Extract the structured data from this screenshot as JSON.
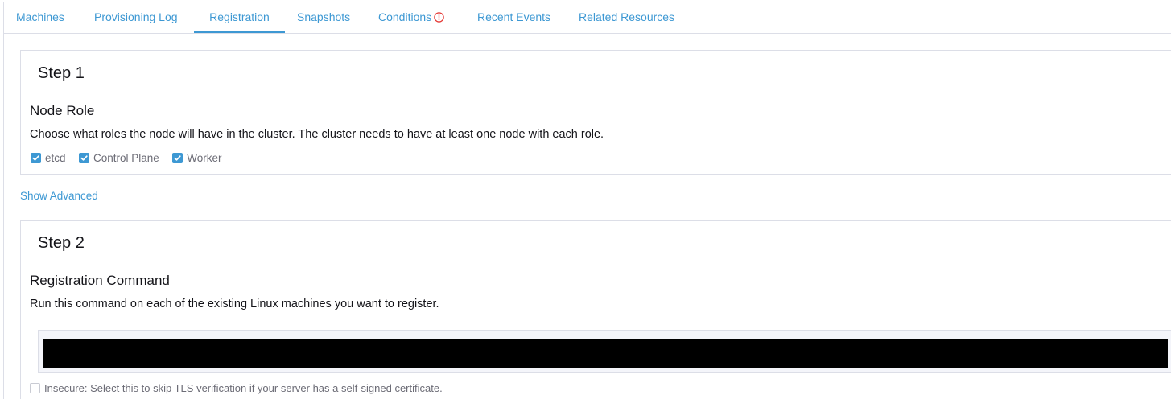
{
  "tabs": [
    {
      "label": "Machines"
    },
    {
      "label": "Provisioning Log"
    },
    {
      "label": "Registration"
    },
    {
      "label": "Snapshots"
    },
    {
      "label": "Conditions"
    },
    {
      "label": "Recent Events"
    },
    {
      "label": "Related Resources"
    }
  ],
  "active_tab": "Registration",
  "colors": {
    "accent": "#3d98d3",
    "warning": "#e53935",
    "border": "#dcdee7"
  },
  "step1": {
    "title": "Step 1",
    "section_title": "Node Role",
    "description": "Choose what roles the node will have in the cluster. The cluster needs to have at least one node with each role.",
    "roles": [
      {
        "label": "etcd",
        "checked": true
      },
      {
        "label": "Control Plane",
        "checked": true
      },
      {
        "label": "Worker",
        "checked": true
      }
    ]
  },
  "show_advanced": "Show Advanced",
  "step2": {
    "title": "Step 2",
    "section_title": "Registration Command",
    "description": "Run this command on each of the existing Linux machines you want to register.",
    "insecure_label": "Insecure: Select this to skip TLS verification if your server has a self-signed certificate.",
    "insecure_checked": false
  }
}
